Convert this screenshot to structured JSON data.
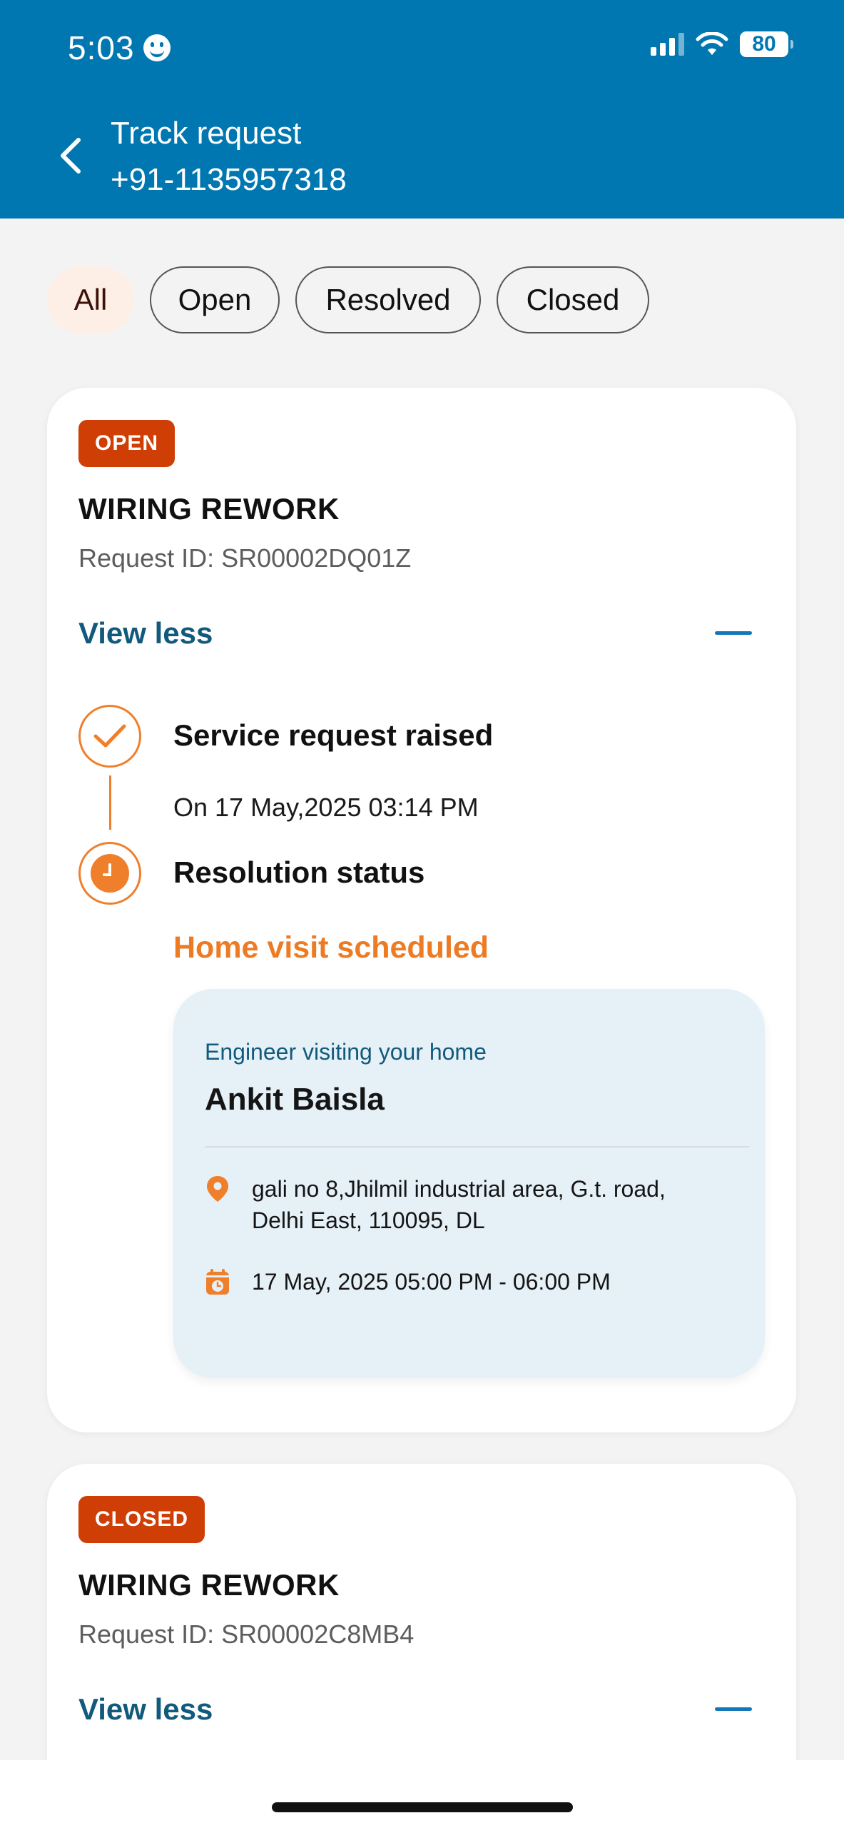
{
  "status_bar": {
    "time": "5:03",
    "battery": "80"
  },
  "header": {
    "title": "Track request",
    "subtitle": "+91-1135957318"
  },
  "filters": [
    {
      "label": "All",
      "active": true
    },
    {
      "label": "Open",
      "active": false
    },
    {
      "label": "Resolved",
      "active": false
    },
    {
      "label": "Closed",
      "active": false
    }
  ],
  "requests": [
    {
      "status": "OPEN",
      "title": "WIRING REWORK",
      "request_id": "Request ID: SR00002DQ01Z",
      "toggle_label": "View less",
      "timeline": [
        {
          "heading": "Service request raised",
          "sub": "On 17 May,2025 03:14 PM"
        },
        {
          "heading": "Resolution status",
          "sub": "Home visit scheduled"
        }
      ],
      "visit": {
        "label": "Engineer visiting your home",
        "engineer": "Ankit Baisla",
        "address_line1": "gali no 8,Jhilmil industrial area, G.t. road,",
        "address_line2": "Delhi East, 110095, DL",
        "slot": "17 May, 2025 05:00 PM - 06:00 PM"
      }
    },
    {
      "status": "CLOSED",
      "title": "WIRING REWORK",
      "request_id": "Request ID: SR00002C8MB4",
      "toggle_label": "View less"
    }
  ],
  "colors": {
    "header_blue": "#0077b0",
    "badge": "#cf3e05",
    "accent_orange": "#ec7b24",
    "link_blue": "#115a7c"
  }
}
